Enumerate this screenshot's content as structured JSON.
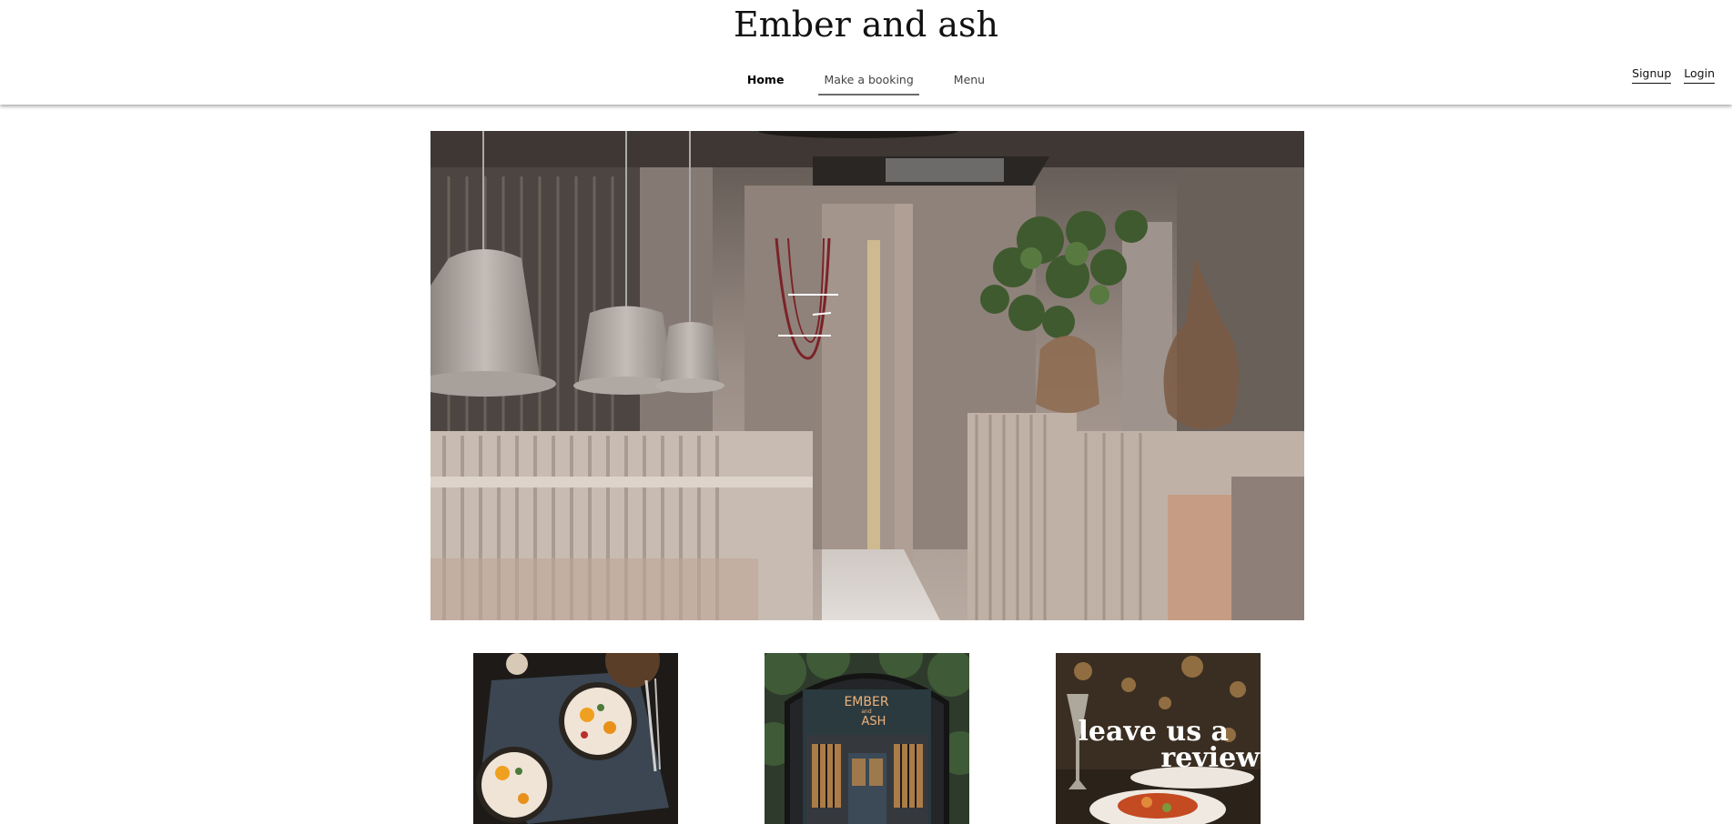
{
  "site": {
    "title": "Ember and ash"
  },
  "nav": {
    "items": [
      {
        "label": "Home",
        "active": true
      },
      {
        "label": "Make a booking",
        "active": false
      },
      {
        "label": "Menu",
        "active": false
      }
    ]
  },
  "auth": {
    "signup_label": "Signup",
    "login_label": "Login"
  },
  "hero": {
    "alt": "Restaurant interior with pendant lamps and booth seating"
  },
  "tiles": [
    {
      "name": "food-photo",
      "caption": ""
    },
    {
      "name": "storefront-photo",
      "sign_line1": "EMBER",
      "sign_line2": "and",
      "sign_line3": "ASH"
    },
    {
      "name": "review-photo",
      "caption_line1": "leave us a",
      "caption_line2": "review"
    }
  ],
  "colors": {
    "nav_underline": "#6b6b6b",
    "accent_sign": "#f0b27a"
  }
}
